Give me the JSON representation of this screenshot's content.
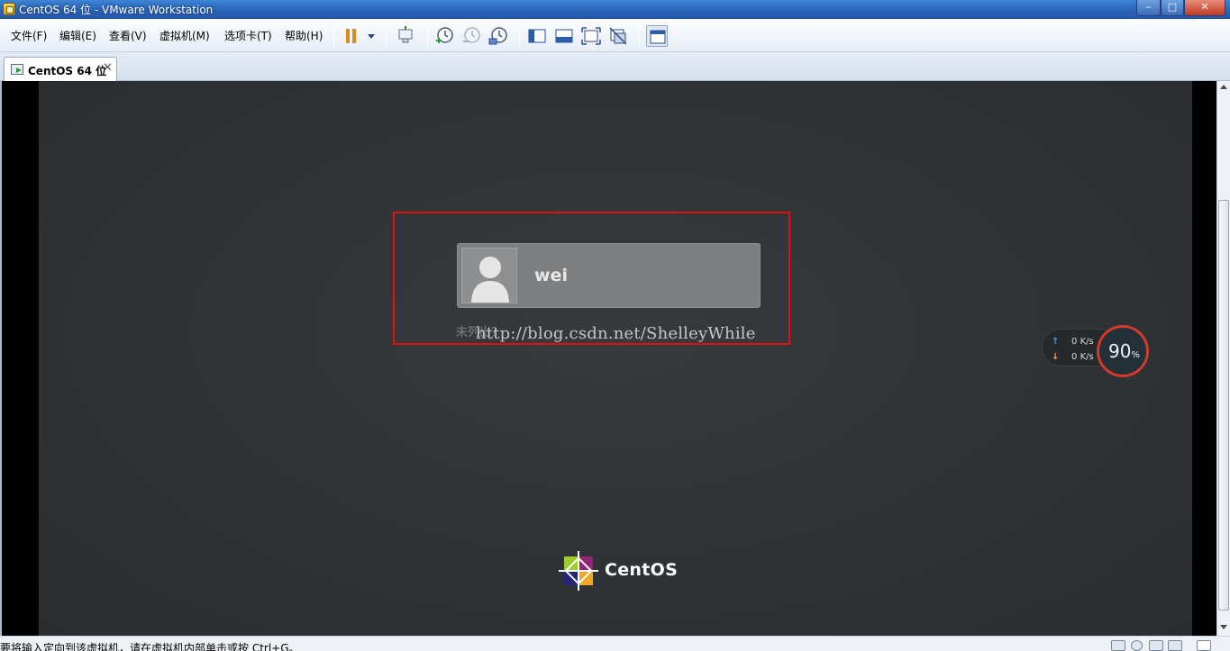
{
  "window": {
    "title": "CentOS 64 位 - VMware Workstation",
    "controls": {
      "minimize": "–",
      "maximize": "□",
      "close": "✕"
    }
  },
  "menu": {
    "items": [
      "文件(F)",
      "编辑(E)",
      "查看(V)",
      "虚拟机(M)",
      "选项卡(T)",
      "帮助(H)"
    ]
  },
  "toolbar": {
    "icons": [
      "pause-icon",
      "dropdown-icon",
      "send-ctrl-alt-del-icon",
      "snapshot-take-icon",
      "snapshot-revert-icon",
      "snapshot-manager-icon",
      "show-sidebar-icon",
      "quick-switch-icon",
      "fullscreen-icon",
      "unity-icon",
      "console-view-icon"
    ]
  },
  "tabs": [
    {
      "label": "CentOS 64 位",
      "close": "✕"
    }
  ],
  "vm": {
    "login": {
      "username": "wei",
      "not_listed": "未列出？"
    },
    "watermark": "http://blog.csdn.net/ShelleyWhile",
    "brand": "CentOS"
  },
  "net_widget": {
    "upload": "0",
    "download": "0",
    "unit": "K/s",
    "up_arrow": "↑",
    "down_arrow": "↓",
    "gauge_value": "90",
    "gauge_unit": "%"
  },
  "status": {
    "message": "要将输入定向到该虚拟机，请在虚拟机内部单击或按 Ctrl+G。"
  },
  "colors": {
    "highlight": "#e01010",
    "vm_background": "#2e3134",
    "gauge_ring": "#d23a2c"
  }
}
